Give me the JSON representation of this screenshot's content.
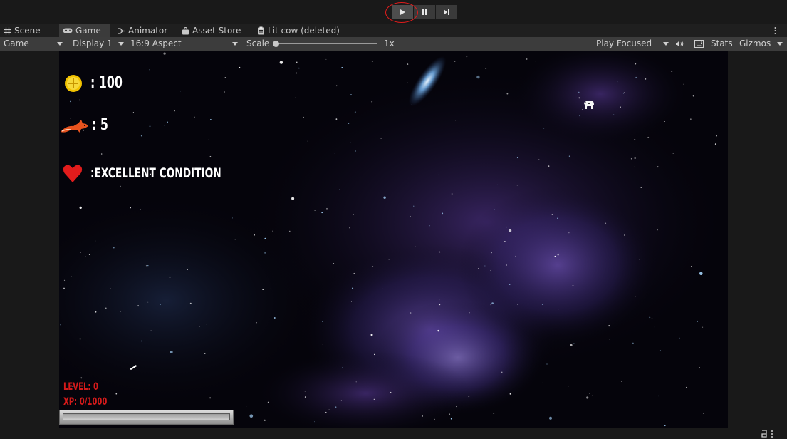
{
  "tabs": [
    {
      "label": "Scene",
      "icon": "grid-icon"
    },
    {
      "label": "Game",
      "icon": "gamepad-icon"
    },
    {
      "label": "Animator",
      "icon": "animator-icon"
    },
    {
      "label": "Asset Store",
      "icon": "shopping-bag-icon"
    },
    {
      "label": "Lit cow (deleted)",
      "icon": "clipboard-icon"
    }
  ],
  "game_toolbar": {
    "view_select": "Game",
    "display": "Display 1",
    "aspect": "16:9 Aspect",
    "scale_label": "Scale",
    "scale_value": "1x",
    "scale_level": 0,
    "play_mode": "Play Focused",
    "stats_label": "Stats",
    "gizmos_label": "Gizmos"
  },
  "hud": {
    "coins": ": 100",
    "lives": ": 5",
    "condition": ":EXCELLENT CONDITION",
    "level": "LEVEL: 0",
    "xp": "XP: 0/1000",
    "xp_progress": 0
  },
  "colors": {
    "accent_red": "#d41a1a",
    "coin_gold": "#f2c200",
    "heart_red": "#e21c1c",
    "fox_orange": "#e8531e"
  },
  "status_bar": {
    "icon": "account-icon"
  }
}
